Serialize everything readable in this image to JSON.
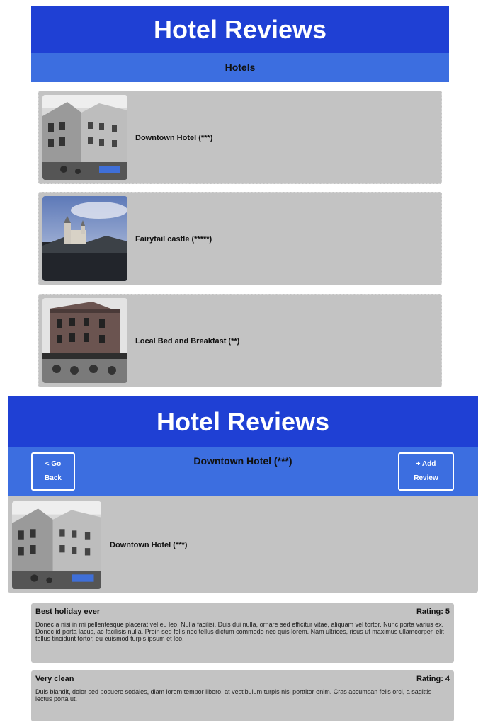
{
  "list_screen": {
    "app_title": "Hotel Reviews",
    "section_title": "Hotels",
    "hotels": [
      {
        "name": "Downtown Hotel (***)"
      },
      {
        "name": "Fairytail castle (*****)"
      },
      {
        "name": "Local Bed and Breakfast (**)"
      }
    ]
  },
  "detail_screen": {
    "app_title": "Hotel Reviews",
    "back_button": {
      "line1": "< Go",
      "line2": "Back"
    },
    "add_button": {
      "line1": "+ Add",
      "line2": "Review"
    },
    "hotel_title": "Downtown Hotel (***)",
    "hotel_name": "Downtown Hotel (***)",
    "rating_label": "Rating:",
    "reviews": [
      {
        "title": "Best holiday ever",
        "rating": 5,
        "text": "Donec a nisi in mi pellentesque placerat vel eu leo. Nulla facilisi. Duis dui nulla, ornare sed efficitur vitae, aliquam vel tortor. Nunc porta varius ex. Donec id porta lacus, ac facilisis nulla. Proin sed felis nec tellus dictum commodo nec quis lorem. Nam ultrices, risus ut maximus ullamcorper, elit tellus tincidunt tortor, eu euismod turpis ipsum et leo."
      },
      {
        "title": "Very clean",
        "rating": 4,
        "text": "Duis blandit, dolor sed posuere sodales, diam lorem tempor libero, at vestibulum turpis nisl porttitor enim. Cras accumsan felis orci, a sagittis lectus porta ut."
      }
    ]
  },
  "colors": {
    "title_bar": "#1f40d4",
    "sub_bar": "#3c6ee0",
    "card": "#c3c3c3"
  }
}
